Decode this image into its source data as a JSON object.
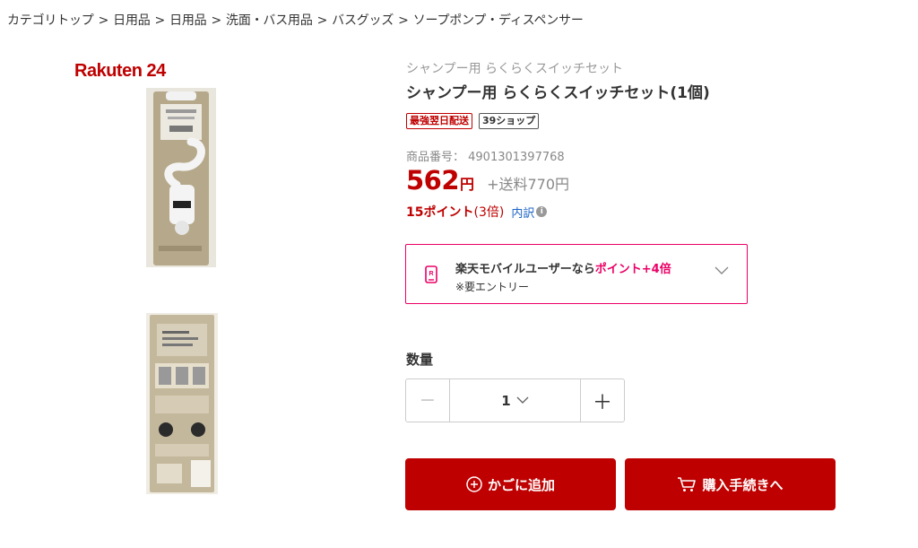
{
  "breadcrumb": [
    {
      "label": "カテゴリトップ"
    },
    {
      "label": "日用品"
    },
    {
      "label": "日用品"
    },
    {
      "label": "洗面・バス用品"
    },
    {
      "label": "バスグッズ"
    },
    {
      "label": "ソープポンプ・ディスペンサー"
    }
  ],
  "brand": {
    "logo_text": "Rakuten 24"
  },
  "product": {
    "subtitle": "シャンプー用 らくらくスイッチセット",
    "title": "シャンプー用 らくらくスイッチセット(1個)",
    "badges": [
      "最強翌日配送",
      "39ショップ"
    ],
    "sku": "商品番号： 4901301397768",
    "price_value": "562",
    "price_unit": "円",
    "shipping": "+送料770円",
    "points": "15ポイント",
    "points_multiplier": "(3倍)",
    "points_breakdown": "内訳",
    "info_icon": "i"
  },
  "mobile_promo": {
    "text_prefix": "楽天モバイルユーザーなら",
    "text_highlight": "ポイント+4倍",
    "note": "※要エントリー",
    "icon": "rakuten-mobile-icon",
    "icon_letter": "R"
  },
  "quantity": {
    "label": "数量",
    "minus": "−",
    "value": "1",
    "plus": "＋"
  },
  "actions": {
    "add_to_cart": "かごに追加",
    "checkout": "購入手続きへ"
  },
  "colors": {
    "accent": "#bf0000",
    "mobile_accent": "#eb0066",
    "link": "#1d64c7"
  }
}
